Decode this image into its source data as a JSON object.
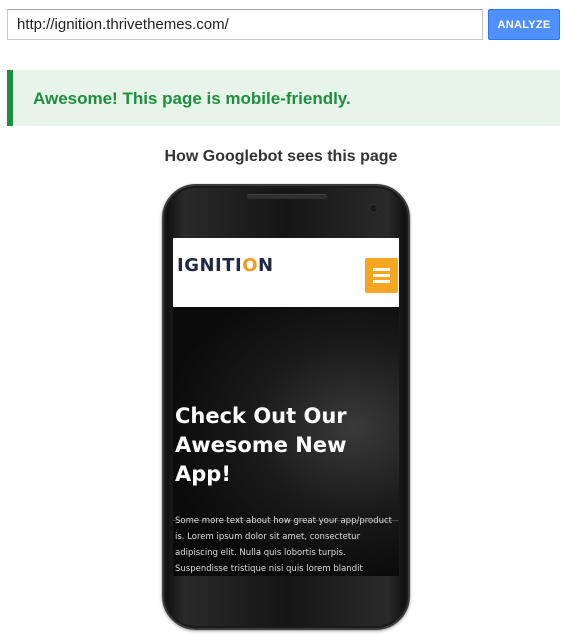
{
  "toolbar": {
    "url_value": "http://ignition.thrivethemes.com/",
    "analyze_label": "ANALYZE"
  },
  "result": {
    "message": "Awesome! This page is mobile-friendly.",
    "status_color": "#1e8e3e"
  },
  "preview": {
    "title": "How Googlebot sees this page",
    "site": {
      "logo_prefix": "IGNITI",
      "logo_o": "O",
      "logo_suffix": "N",
      "menu_icon": "hamburger-menu-icon",
      "hero_title": "Check Out Our Awesome New App!",
      "hero_body": "Some more text about how great your app/product is. Lorem ipsum dolor sit amet, consectetur adipiscing elit. Nulla quis lobortis turpis. Suspendisse tristique nisi quis lorem blandit"
    }
  }
}
